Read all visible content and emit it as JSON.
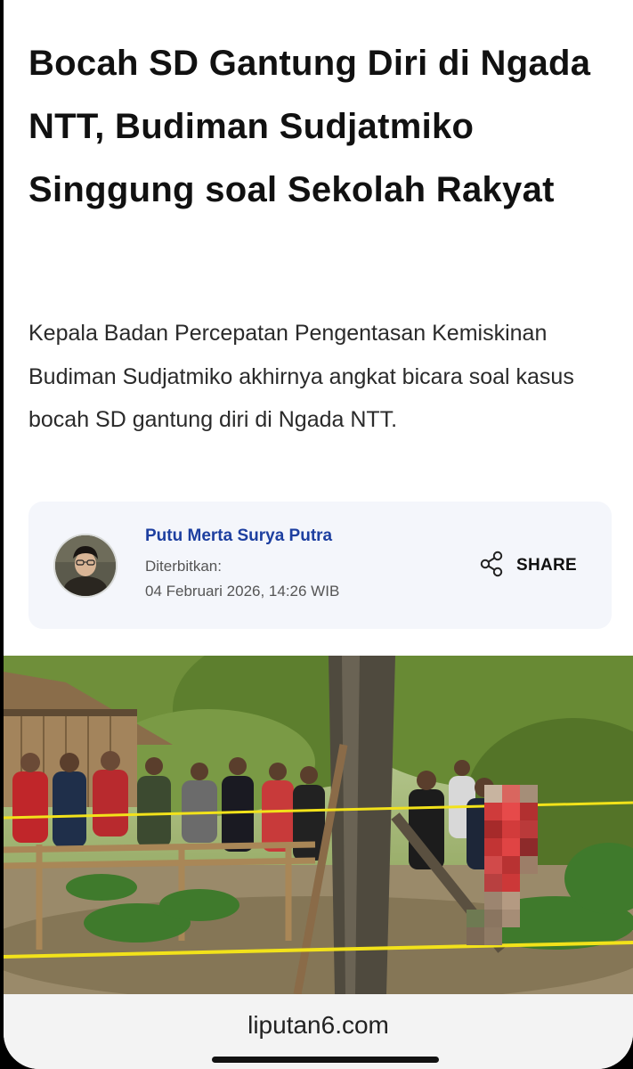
{
  "article": {
    "title": "Bocah SD Gantung Diri di Ngada NTT, Budiman Sudjatmiko Singgung soal Sekolah Rakyat",
    "lead": "Kepala Badan Percepatan Pengentasan Kemiskinan Budiman Sudjatmiko akhirnya angkat bicara soal kasus bocah SD gantung diri di Ngada NTT."
  },
  "author": {
    "name": "Putu Merta Surya Putra",
    "published_label": "Diterbitkan:",
    "published_date": "04 Februari 2026, 14:26 WIB"
  },
  "share": {
    "label": "SHARE",
    "icon": "share-icon"
  },
  "browser": {
    "domain": "liputan6.com"
  },
  "colors": {
    "author_name": "#1d3fa0",
    "card_background": "#f4f6fb",
    "police_line": "#f2e21a"
  }
}
